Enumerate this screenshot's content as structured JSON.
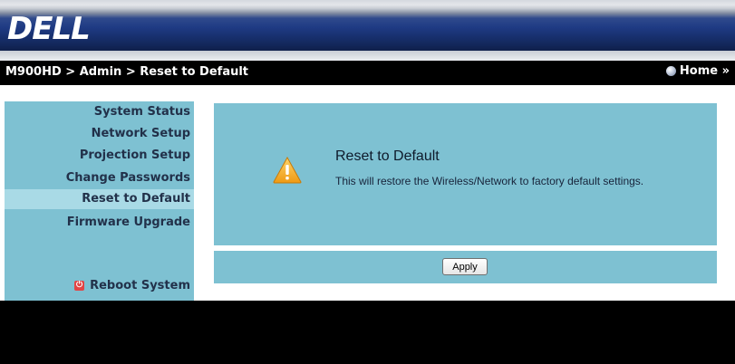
{
  "header": {
    "logo_text": "DELL"
  },
  "navbar": {
    "breadcrumb": "M900HD > Admin > Reset to Default",
    "home_label": "Home »"
  },
  "sidebar": {
    "items": [
      {
        "label": "System Status"
      },
      {
        "label": "Network Setup"
      },
      {
        "label": "Projection Setup"
      },
      {
        "label": "Change Passwords"
      },
      {
        "label": "Reset to Default",
        "active": true
      },
      {
        "label": "Firmware Upgrade"
      }
    ],
    "reboot_label": "Reboot System"
  },
  "main": {
    "icon": "warning-icon",
    "title": "Reset to Default",
    "description": "This will restore the Wireless/Network to factory default settings.",
    "apply_label": "Apply"
  },
  "colors": {
    "panel": "#7ec1d2",
    "active_item": "#a9dae6",
    "warning": "#f2a51c",
    "reboot_icon": "#e24545"
  }
}
